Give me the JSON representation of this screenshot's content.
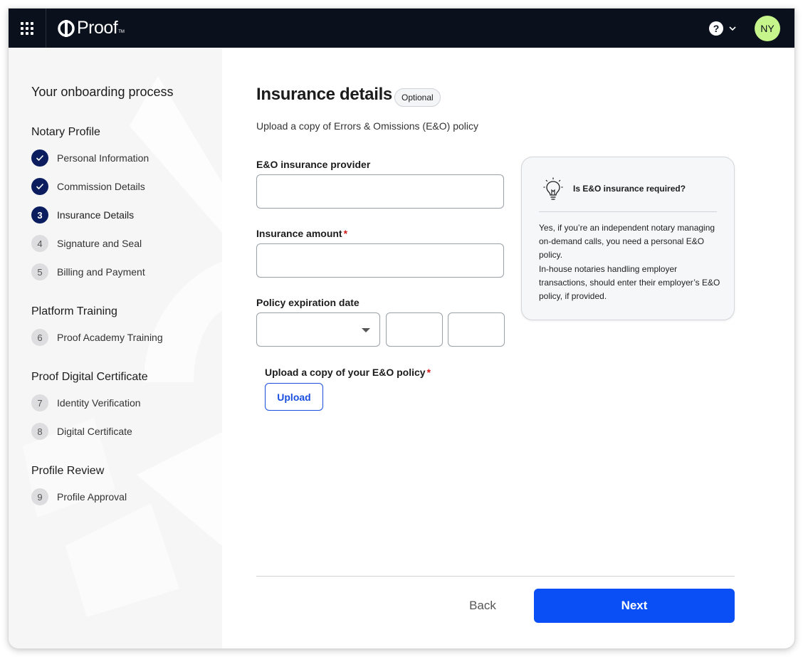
{
  "app": {
    "logo_text": "Proof",
    "logo_tm": "TM",
    "avatar_initials": "NY",
    "brand_color": "#0a4ff5",
    "avatar_color": "#c5f58b"
  },
  "sidebar": {
    "title": "Your onboarding process",
    "sections": [
      {
        "title": "Notary Profile",
        "steps": [
          {
            "badge": "",
            "label": "Personal Information",
            "status": "done"
          },
          {
            "badge": "",
            "label": "Commission Details",
            "status": "done"
          },
          {
            "badge": "3",
            "label": "Insurance Details",
            "status": "current"
          },
          {
            "badge": "4",
            "label": "Signature and Seal",
            "status": "todo"
          },
          {
            "badge": "5",
            "label": "Billing and Payment",
            "status": "todo"
          }
        ]
      },
      {
        "title": "Platform Training",
        "steps": [
          {
            "badge": "6",
            "label": "Proof Academy Training",
            "status": "todo"
          }
        ]
      },
      {
        "title": "Proof Digital Certificate",
        "steps": [
          {
            "badge": "7",
            "label": "Identity Verification",
            "status": "todo"
          },
          {
            "badge": "8",
            "label": "Digital Certificate",
            "status": "todo"
          }
        ]
      },
      {
        "title": "Profile Review",
        "steps": [
          {
            "badge": "9",
            "label": "Profile Approval",
            "status": "todo"
          }
        ]
      }
    ]
  },
  "main": {
    "title": "Insurance details",
    "optional_badge": "Optional",
    "subtitle": "Upload a copy of Errors & Omissions (E&O) policy",
    "provider_label": "E&O insurance provider",
    "provider_value": "",
    "amount_label": "Insurance amount",
    "amount_value": "",
    "required_marker": "*",
    "expiration_label": "Policy expiration date",
    "expiration_month": "",
    "expiration_day": "",
    "expiration_year": "",
    "upload_label": "Upload a copy of your E&O policy",
    "upload_button": "Upload"
  },
  "info_card": {
    "title": "Is E&O insurance required?",
    "body": "Yes, if you’re an independent notary managing on-demand calls, you need a personal E&O policy.\nIn-house notaries handling employer transactions, should enter their employer’s E&O policy, if provided.",
    "icon": "lightbulb-icon"
  },
  "footer": {
    "back_label": "Back",
    "next_label": "Next"
  }
}
